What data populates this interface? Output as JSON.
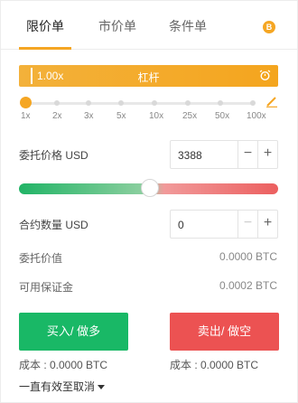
{
  "tabs": {
    "limit": "限价单",
    "market": "市价单",
    "conditional": "条件单",
    "coin_icon": "B"
  },
  "leverage": {
    "value": "1.00x",
    "label": "杠杆",
    "icon": "alarm-clock-icon",
    "slider_fraction": 0.0,
    "scale": [
      "1x",
      "2x",
      "3x",
      "5x",
      "10x",
      "25x",
      "50x",
      "100x"
    ]
  },
  "order_price": {
    "label": "委托价格 USD",
    "value": "3388",
    "minus": "−",
    "plus": "+"
  },
  "quantity": {
    "label": "合约数量 USD",
    "value": "0",
    "minus": "−",
    "plus": "+"
  },
  "order_value": {
    "label": "委托价值",
    "value": "0.0000 BTC"
  },
  "available_margin": {
    "label": "可用保证金",
    "value": "0.0002 BTC"
  },
  "buy": {
    "label": "买入/ 做多",
    "cost": "成本 : 0.0000 BTC",
    "color": "#19b866"
  },
  "sell": {
    "label": "卖出/ 做空",
    "cost": "成本 : 0.0000 BTC",
    "color": "#ec5252"
  },
  "time_in_force": "一直有效至取消",
  "accent_color": "#f5a623"
}
